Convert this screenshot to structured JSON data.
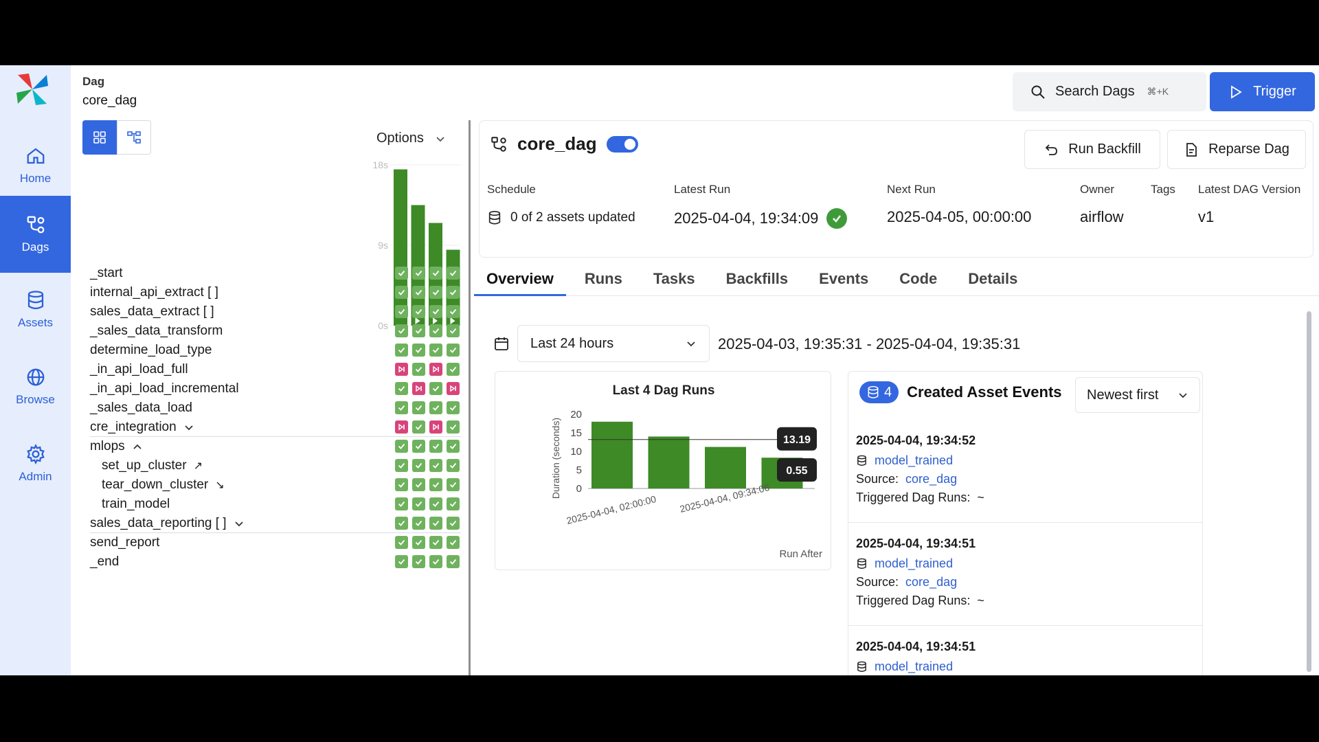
{
  "nav": {
    "items": [
      {
        "label": "Home",
        "icon": "home-icon"
      },
      {
        "label": "Dags",
        "icon": "dags-icon",
        "active": true
      },
      {
        "label": "Assets",
        "icon": "database-icon"
      },
      {
        "label": "Browse",
        "icon": "globe-icon"
      },
      {
        "label": "Admin",
        "icon": "gear-icon"
      }
    ]
  },
  "breadcrumb": {
    "label": "Dag",
    "value": "core_dag"
  },
  "options_label": "Options",
  "mini_chart": {
    "type": "bar",
    "yticks": [
      "18s",
      "9s",
      "0s"
    ],
    "ylim": [
      0,
      18
    ],
    "values": [
      17.5,
      13.5,
      11.5,
      8.5
    ]
  },
  "tasks": [
    {
      "name": "_start",
      "status": [
        "ok",
        "ok",
        "ok",
        "ok"
      ]
    },
    {
      "name": "internal_api_extract [ ]",
      "status": [
        "ok",
        "ok",
        "ok",
        "ok"
      ]
    },
    {
      "name": "sales_data_extract [ ]",
      "status": [
        "ok",
        "ok",
        "ok",
        "ok"
      ]
    },
    {
      "name": "_sales_data_transform",
      "status": [
        "ok",
        "ok",
        "ok",
        "ok"
      ]
    },
    {
      "name": "determine_load_type",
      "status": [
        "ok",
        "ok",
        "ok",
        "ok"
      ]
    },
    {
      "name": "_in_api_load_full",
      "status": [
        "sk",
        "ok",
        "sk",
        "ok"
      ]
    },
    {
      "name": "_in_api_load_incremental",
      "status": [
        "ok",
        "sk",
        "ok",
        "sk"
      ]
    },
    {
      "name": "_sales_data_load",
      "status": [
        "ok",
        "ok",
        "ok",
        "ok"
      ]
    },
    {
      "name": "cre_integration",
      "status": [
        "sk",
        "ok",
        "sk",
        "ok"
      ]
    },
    {
      "name": "mlops",
      "status": [
        "ok",
        "ok",
        "ok",
        "ok"
      ]
    },
    {
      "name": "set_up_cluster",
      "status": [
        "ok",
        "ok",
        "ok",
        "ok"
      ]
    },
    {
      "name": "tear_down_cluster",
      "status": [
        "ok",
        "ok",
        "ok",
        "ok"
      ]
    },
    {
      "name": "train_model",
      "status": [
        "ok",
        "ok",
        "ok",
        "ok"
      ]
    },
    {
      "name": "sales_data_reporting [ ]",
      "status": [
        "ok",
        "ok",
        "ok",
        "ok"
      ]
    },
    {
      "name": "send_report",
      "status": [
        "ok",
        "ok",
        "ok",
        "ok"
      ]
    },
    {
      "name": "_end",
      "status": [
        "ok",
        "ok",
        "ok",
        "ok"
      ]
    }
  ],
  "header": {
    "search_label": "Search Dags",
    "search_kbd": "⌘+K",
    "trigger_label": "Trigger"
  },
  "dag": {
    "title": "core_dag",
    "run_backfill_label": "Run Backfill",
    "reparse_label": "Reparse Dag",
    "schedule_label": "Schedule",
    "schedule_value": "0 of 2 assets updated",
    "latest_run_label": "Latest Run",
    "latest_run_value": "2025-04-04, 19:34:09",
    "next_run_label": "Next Run",
    "next_run_value": "2025-04-05, 00:00:00",
    "owner_label": "Owner",
    "owner_value": "airflow",
    "tags_label": "Tags",
    "version_label": "Latest DAG Version",
    "version_value": "v1"
  },
  "tabs": [
    "Overview",
    "Runs",
    "Tasks",
    "Backfills",
    "Events",
    "Code",
    "Details"
  ],
  "range": {
    "selected": "Last 24 hours",
    "text": "2025-04-03, 19:35:31 - 2025-04-04, 19:35:31"
  },
  "chart_data": {
    "type": "bar",
    "title": "Last 4 Dag Runs",
    "ylabel": "Duration (seconds)",
    "xlabel": "Run After",
    "ylim": [
      0,
      20
    ],
    "yticks": [
      0,
      5,
      10,
      15,
      20
    ],
    "xtick_labels": [
      "2025-04-04, 02:00:00",
      "2025-04-04, 09:34:06"
    ],
    "values": [
      18,
      14,
      11.2,
      8.3
    ],
    "reference_lines": [
      {
        "label": "13.19",
        "value": 13.19
      },
      {
        "label": "0.55",
        "value": 0.55
      }
    ],
    "color": "#3d8a27"
  },
  "events": {
    "count": "4",
    "title": "Created Asset Events",
    "sort": "Newest first",
    "source_label": "Source:",
    "triggered_label": "Triggered Dag Runs:",
    "items": [
      {
        "ts": "2025-04-04, 19:34:52",
        "asset": "model_trained",
        "source": "core_dag",
        "triggered": "~"
      },
      {
        "ts": "2025-04-04, 19:34:51",
        "asset": "model_trained",
        "source": "core_dag",
        "triggered": "~"
      },
      {
        "ts": "2025-04-04, 19:34:51",
        "asset": "model_trained",
        "source": "",
        "triggered": ""
      }
    ]
  }
}
